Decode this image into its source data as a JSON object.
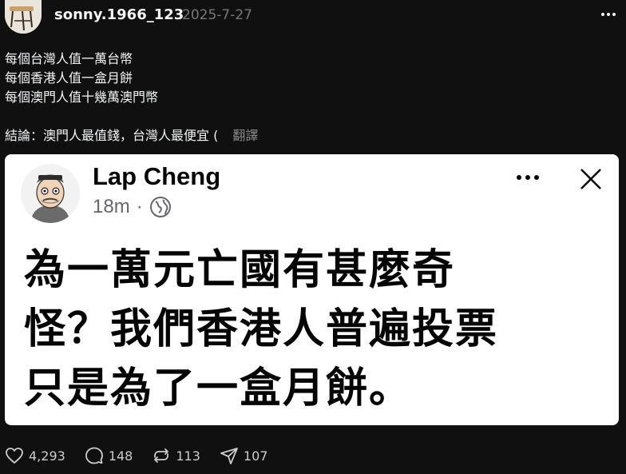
{
  "post": {
    "username": "sonny.1966_123",
    "timestamp": "2025-7-27",
    "lines": [
      "每個台灣人值一萬台幣",
      "每個香港人值一盒月餅",
      "每個澳門人值十幾萬澳門幣"
    ],
    "conclusion": "結論：澳門人最值錢，台灣人最便宜 (",
    "translate_label": "翻譯"
  },
  "card": {
    "author": "Lap Cheng",
    "time": "18m",
    "separator": "·",
    "text_lines": [
      "為一萬元亡國有甚麼奇",
      "怪？我們香港人普遍投票",
      "只是為了一盒月餅。"
    ]
  },
  "actions": {
    "likes": "4,293",
    "comments": "148",
    "reposts": "113",
    "shares": "107"
  },
  "icons": {
    "more": "more-horizontal-icon",
    "like": "heart-icon",
    "comment": "comment-icon",
    "repost": "repost-icon",
    "share": "send-icon",
    "close": "close-icon",
    "globe": "globe-icon"
  }
}
